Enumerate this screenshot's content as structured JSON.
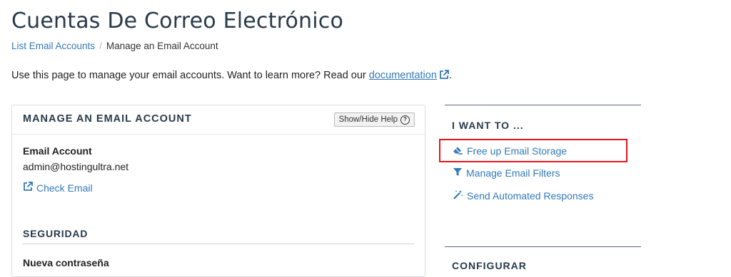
{
  "page": {
    "title": "Cuentas De Correo Electrónico",
    "breadcrumb": {
      "link": "List Email Accounts",
      "separator": "/",
      "current": "Manage an Email Account"
    },
    "intro": {
      "text": "Use this page to manage your email accounts. Want to learn more? Read our ",
      "link": "documentation",
      "suffix": "."
    }
  },
  "panel": {
    "title": "MANAGE AN EMAIL ACCOUNT",
    "help_button": "Show/Hide Help",
    "email_label": "Email Account",
    "email_value": "admin@hostingultra.net",
    "check_email": "Check Email",
    "security_title": "SEGURIDAD",
    "password_label": "Nueva contraseña"
  },
  "sidebar": {
    "title": "I WANT TO ...",
    "links": [
      {
        "label": "Free up Email Storage",
        "icon": "eraser-icon"
      },
      {
        "label": "Manage Email Filters",
        "icon": "filter-icon"
      },
      {
        "label": "Send Automated Responses",
        "icon": "magic-wand-icon"
      }
    ],
    "next_section_title": "CONFIGURAR"
  },
  "colors": {
    "link": "#337ab7",
    "heading": "#293a4a",
    "highlight": "#e8141c"
  }
}
